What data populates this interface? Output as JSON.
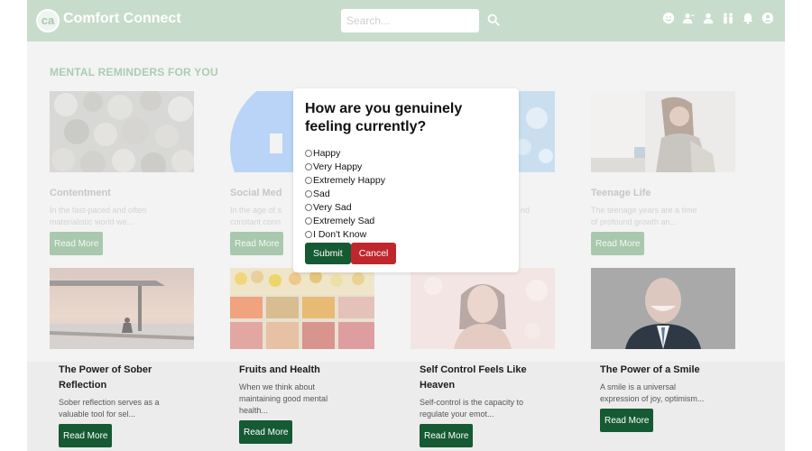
{
  "header": {
    "brand": "Comfort Connect",
    "search_placeholder": "Search...",
    "logo_text": "ca",
    "icons": [
      "smiley-icon",
      "contacts-icon",
      "profile-icon",
      "community-icon",
      "notifications-icon",
      "account-icon"
    ]
  },
  "section_title": "MENTAL REMINDERS FOR YOU",
  "cards_row1": [
    {
      "title": "Contentment",
      "desc": "In the fast-paced and often materialistic world we...",
      "button": "Read More"
    },
    {
      "title": "Social Med",
      "desc": "In the age of s constant conn",
      "button": "Read More"
    },
    {
      "title": "",
      "desc": "nd",
      "button": ""
    },
    {
      "title": "Teenage Life",
      "desc": "The teenage years are a time of profound growth an...",
      "button": "Read More"
    }
  ],
  "cards_row2": [
    {
      "title": "The Power of Sober Reflection",
      "desc": "Sober reflection serves as a valuable tool for sel...",
      "button": "Read More"
    },
    {
      "title": "Fruits and Health",
      "desc": "When we think about maintaining good mental health...",
      "button": "Read More"
    },
    {
      "title": "Self Control Feels Like Heaven",
      "desc": "Self-control is the capacity to regulate your emot...",
      "button": "Read More"
    },
    {
      "title": "The Power of a Smile",
      "desc": "A smile is a universal expression of joy, optimism...",
      "button": "Read More"
    }
  ],
  "modal": {
    "question": "How are you genuinely feeling currently?",
    "options": [
      "Happy",
      "Very Happy",
      "Extremely Happy",
      "Sad",
      "Very Sad",
      "Extremely Sad",
      "I Don't Know"
    ],
    "submit": "Submit",
    "cancel": "Cancel"
  },
  "colors": {
    "header_bg": "#c8dccb",
    "button_dark": "#155a33",
    "button_faded": "#a9c8ae",
    "cancel_red": "#c0272d",
    "section_title": "#aacdb0"
  }
}
